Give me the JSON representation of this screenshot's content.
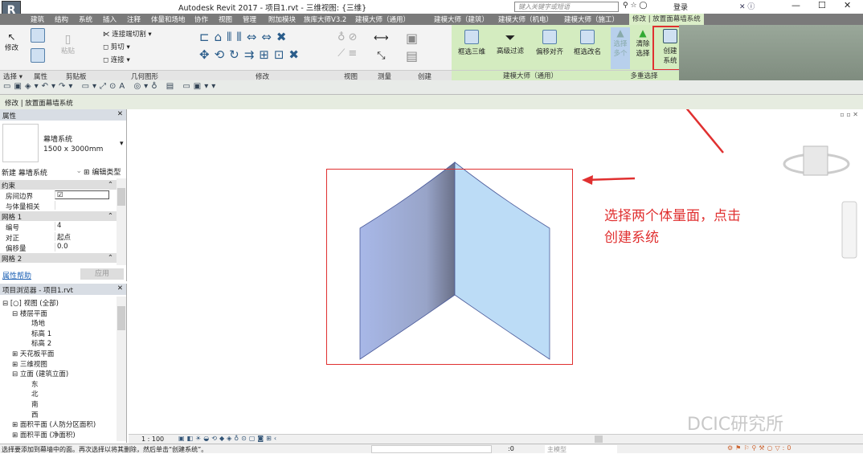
{
  "title": "Autodesk Revit 2017 -      项目1.rvt - 三维视图: {三维}",
  "search_placeholder": "键入关键字或短语",
  "login": "登录",
  "tabs": [
    "建筑",
    "结构",
    "系统",
    "插入",
    "注释",
    "体量和场地",
    "协作",
    "视图",
    "管理",
    "附加模块",
    "族库大师V3.2",
    "建模大师（通用）",
    "建模大师（建筑）",
    "建模大师（机电）",
    "建模大师（施工）",
    "修改 | 放置面幕墙系统"
  ],
  "ribbon": {
    "modify": "修改",
    "paste": "粘贴",
    "cut_join": "连接端切割",
    "cut": "剪切",
    "join": "连接",
    "box3d": "框选三维",
    "adv_filter": "高级过滤",
    "offset_align": "偏移对齐",
    "box_rename": "框选改名",
    "select_multi": "选择多个",
    "clear_select": "清除选择",
    "create_system": "创建系统"
  },
  "panels": [
    "选择 ▾",
    "属性",
    "剪贴板",
    "几何图形",
    "修改",
    "视图",
    "测量",
    "创建",
    "建模大师（通用）",
    "多重选择"
  ],
  "context": "修改 | 放置面幕墙系统",
  "properties": {
    "title": "属性",
    "type_name": "幕墙系统",
    "type_size": "1500 x 3000mm",
    "instance": "新建 幕墙系统",
    "edit_type": "编辑类型",
    "rows": [
      {
        "k": "约束",
        "sec": true
      },
      {
        "k": "房间边界",
        "v": "☑"
      },
      {
        "k": "与体量相关",
        "v": ""
      },
      {
        "k": "网格 1",
        "sec": true
      },
      {
        "k": "编号",
        "v": "4"
      },
      {
        "k": "对正",
        "v": "起点"
      },
      {
        "k": "偏移量",
        "v": "0.0"
      },
      {
        "k": "网格 2",
        "sec": true
      }
    ],
    "help": "属性帮助",
    "apply": "应用"
  },
  "browser": {
    "title": "项目浏览器 - 项目1.rvt",
    "items": [
      {
        "t": "⊟ [○] 视图 (全部)",
        "l": 0
      },
      {
        "t": "⊟ 楼层平面",
        "l": 1
      },
      {
        "t": "场地",
        "l": 3
      },
      {
        "t": "标高 1",
        "l": 3
      },
      {
        "t": "标高 2",
        "l": 3
      },
      {
        "t": "⊞ 天花板平面",
        "l": 1
      },
      {
        "t": "⊞ 三维视图",
        "l": 1
      },
      {
        "t": "⊟ 立面 (建筑立面)",
        "l": 1
      },
      {
        "t": "东",
        "l": 3
      },
      {
        "t": "北",
        "l": 3
      },
      {
        "t": "南",
        "l": 3
      },
      {
        "t": "西",
        "l": 3
      },
      {
        "t": "⊞ 面积平面 (人防分区面积)",
        "l": 1
      },
      {
        "t": "⊞ 面积平面 (净面积)",
        "l": 1
      }
    ]
  },
  "annotation": [
    "选择两个体量面，点击",
    "创建系统"
  ],
  "watermark": "DCIC研究所",
  "scale": "1 : 100",
  "status": "选择要添加到幕墙中的面。再次选择以将其删除，然后单击“创建系统”。",
  "status_model": "主模型",
  "status_zero": ":0"
}
